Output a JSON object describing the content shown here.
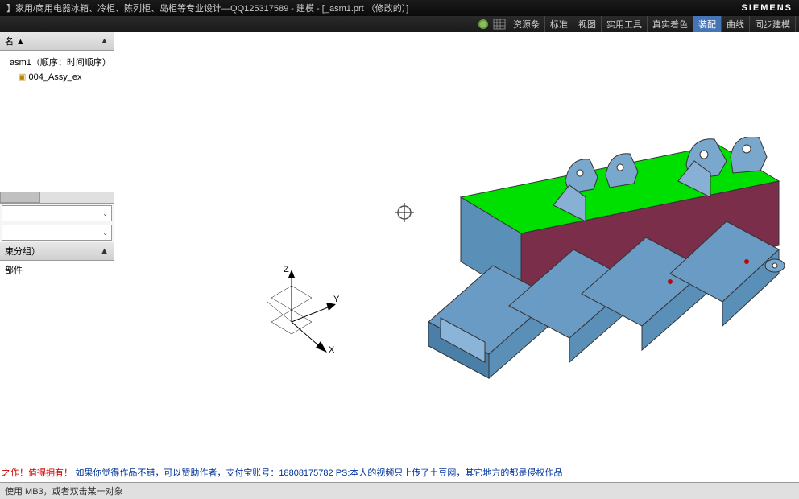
{
  "title": "】家用/商用电器冰箱、冷柜、陈列柜、岛柜等专业设计—QQ125317589 - 建模 - [_asm1.prt （修改的）]",
  "brand": "SIEMENS",
  "tools": {
    "t1": "资源条",
    "t2": "标准",
    "t3": "视图",
    "t4": "实用工具",
    "t5": "真实着色",
    "t6": "装配",
    "t7": "曲线",
    "t8": "同步建模"
  },
  "panel1_header": "名 ▲",
  "tree": {
    "item1": "asm1（顺序：时间顺序）",
    "item2": "004_Assy_ex"
  },
  "panel2_header": "束分组）",
  "panel2_item": "部件",
  "csys": {
    "x": "X",
    "y": "Y",
    "z": "Z"
  },
  "footer_red": "之作！值得拥有！",
  "footer_blue": "如果你觉得作品不错，可以赞助作者，支付宝账号：18808175782 PS:本人的视频只上传了土豆网，其它地方的都是侵权作品",
  "status": "使用 MB3，或者双击某一对象"
}
